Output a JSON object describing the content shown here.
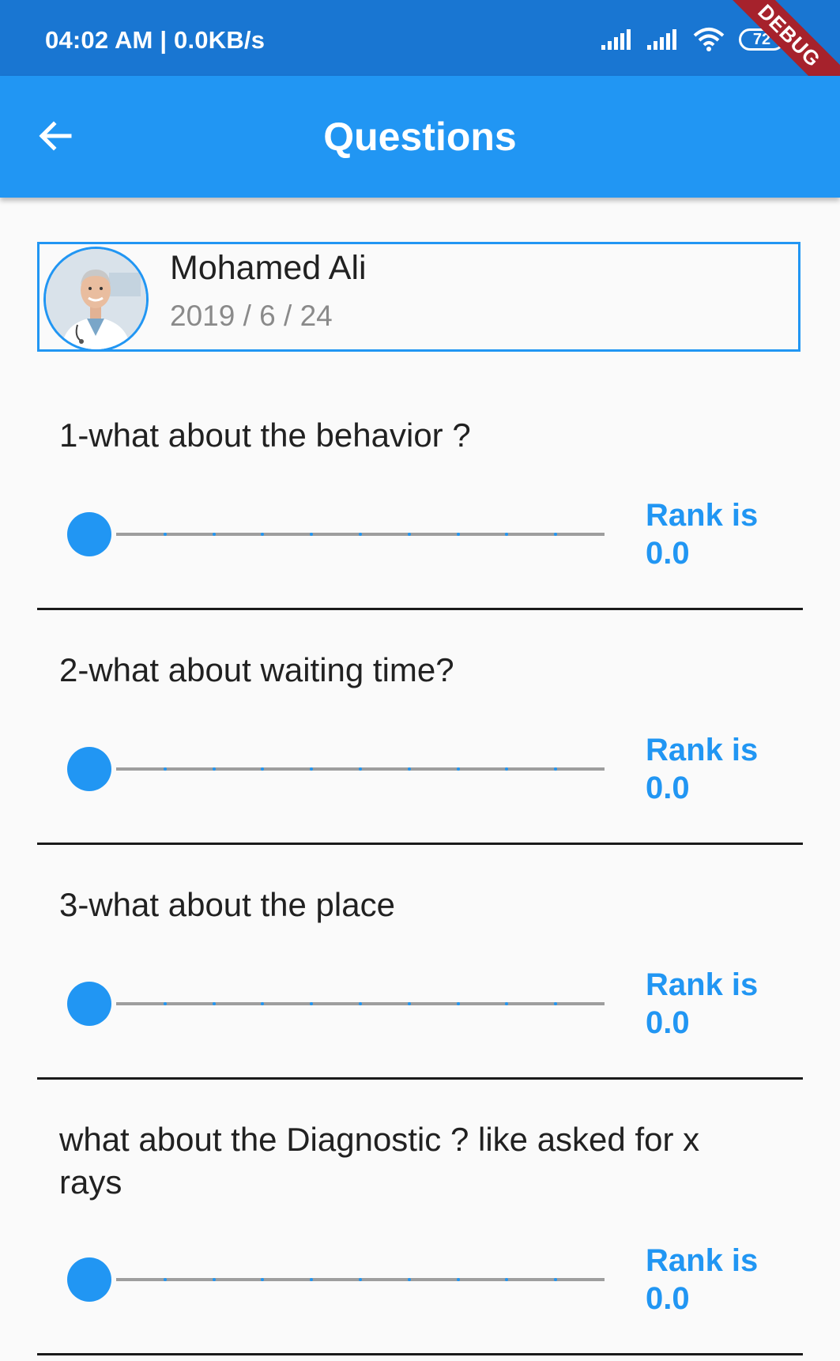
{
  "status_bar": {
    "time": "04:02 AM | 0.0KB/s",
    "battery": "72",
    "debug_label": "DEBUG"
  },
  "app_bar": {
    "title": "Questions",
    "back_icon": "arrow-back-icon"
  },
  "profile": {
    "name": "Mohamed Ali",
    "date": "2019 / 6 / 24"
  },
  "questions": [
    {
      "text": "1-what about the behavior ?",
      "rank_label": "Rank is",
      "rank_value": "0.0",
      "slider_value": 0
    },
    {
      "text": "2-what about waiting time?",
      "rank_label": "Rank is",
      "rank_value": "0.0",
      "slider_value": 0
    },
    {
      "text": "3-what about the place",
      "rank_label": "Rank is",
      "rank_value": "0.0",
      "slider_value": 0
    },
    {
      "text": "what about the Diagnostic ?  like asked for x rays",
      "rank_label": "Rank is",
      "rank_value": "0.0",
      "slider_value": 0
    }
  ],
  "colors": {
    "primary": "#2196f3",
    "status_bar": "#1976d2",
    "debug_banner": "#a6222c"
  }
}
